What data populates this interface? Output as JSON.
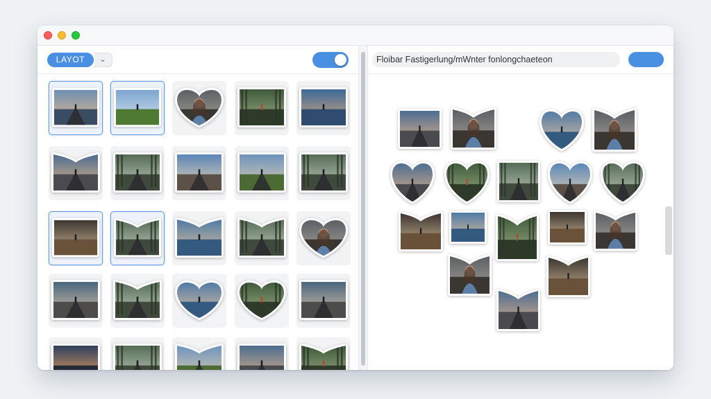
{
  "window": {
    "controls": [
      "close",
      "minimize",
      "zoom"
    ]
  },
  "left_toolbar": {
    "layout_button_label": "LAYOT",
    "dropdown_icon": "chevron-down-icon",
    "dropdown_glyph": "⌄",
    "toggle_on": true
  },
  "right_toolbar": {
    "path_text": "Floibar Fastigerlung/mWnter fonlongchaeteon",
    "apply_button_label": ""
  },
  "colors": {
    "accent": "#4a90e2",
    "selection": "#6b9fe3",
    "window_bg": "#ffffff",
    "page_bg": "#eef2f5"
  },
  "gallery": {
    "rows": [
      [
        {
          "shape": "rect",
          "scene": "pier-sunset",
          "selected": true
        },
        {
          "shape": "rect",
          "scene": "green-field",
          "selected": true
        },
        {
          "shape": "heart",
          "scene": "portrait",
          "selected": false
        },
        {
          "shape": "rect",
          "scene": "forest-figure",
          "selected": false
        },
        {
          "shape": "rect",
          "scene": "lake-boat",
          "selected": false
        }
      ],
      [
        {
          "shape": "notch",
          "scene": "road-dusk",
          "selected": false
        },
        {
          "shape": "rect",
          "scene": "forest-road",
          "selected": false
        },
        {
          "shape": "rect",
          "scene": "road-sky",
          "selected": false
        },
        {
          "shape": "rect",
          "scene": "field-road",
          "selected": false
        },
        {
          "shape": "rect",
          "scene": "forest-road",
          "selected": false
        }
      ],
      [
        {
          "shape": "rect",
          "scene": "interior",
          "selected": true
        },
        {
          "shape": "notch",
          "scene": "forest-road",
          "selected": true
        },
        {
          "shape": "notch",
          "scene": "lake-figure",
          "selected": false
        },
        {
          "shape": "notch",
          "scene": "forest-road",
          "selected": false
        },
        {
          "shape": "heart",
          "scene": "portrait",
          "selected": false
        }
      ],
      [
        {
          "shape": "rect",
          "scene": "interior-road",
          "selected": false
        },
        {
          "shape": "notch",
          "scene": "forest-road",
          "selected": false
        },
        {
          "shape": "heart",
          "scene": "lake-figure",
          "selected": false
        },
        {
          "shape": "heart",
          "scene": "forest-figure",
          "selected": false
        },
        {
          "shape": "rect",
          "scene": "interior-road",
          "selected": false
        }
      ],
      [
        {
          "shape": "rect",
          "scene": "sunset",
          "selected": false
        },
        {
          "shape": "rect",
          "scene": "forest-road",
          "selected": false
        },
        {
          "shape": "notch",
          "scene": "field-road",
          "selected": false
        },
        {
          "shape": "rect",
          "scene": "road-dusk",
          "selected": false
        },
        {
          "shape": "notch",
          "scene": "forest-figure",
          "selected": false
        }
      ]
    ]
  },
  "collage": {
    "layout": "heart",
    "tiles": [
      {
        "shape": "rect",
        "scene": "road-dusk"
      },
      {
        "shape": "notch",
        "scene": "portrait"
      },
      {
        "shape": "heart",
        "scene": "lake-figure"
      },
      {
        "shape": "notch",
        "scene": "portrait"
      },
      {
        "shape": "heart",
        "scene": "road-dusk"
      },
      {
        "shape": "heart",
        "scene": "forest-figure"
      },
      {
        "shape": "rect",
        "scene": "forest-road"
      },
      {
        "shape": "heart",
        "scene": "road-sky"
      },
      {
        "shape": "heart",
        "scene": "forest-road"
      },
      {
        "shape": "notch",
        "scene": "interior"
      },
      {
        "shape": "rect",
        "scene": "lake-figure"
      },
      {
        "shape": "notch",
        "scene": "forest-figure"
      },
      {
        "shape": "rect",
        "scene": "interior"
      },
      {
        "shape": "notch",
        "scene": "portrait"
      },
      {
        "shape": "notch",
        "scene": "portrait"
      },
      {
        "shape": "notch",
        "scene": "interior"
      },
      {
        "shape": "notch",
        "scene": "road-dusk"
      }
    ]
  }
}
